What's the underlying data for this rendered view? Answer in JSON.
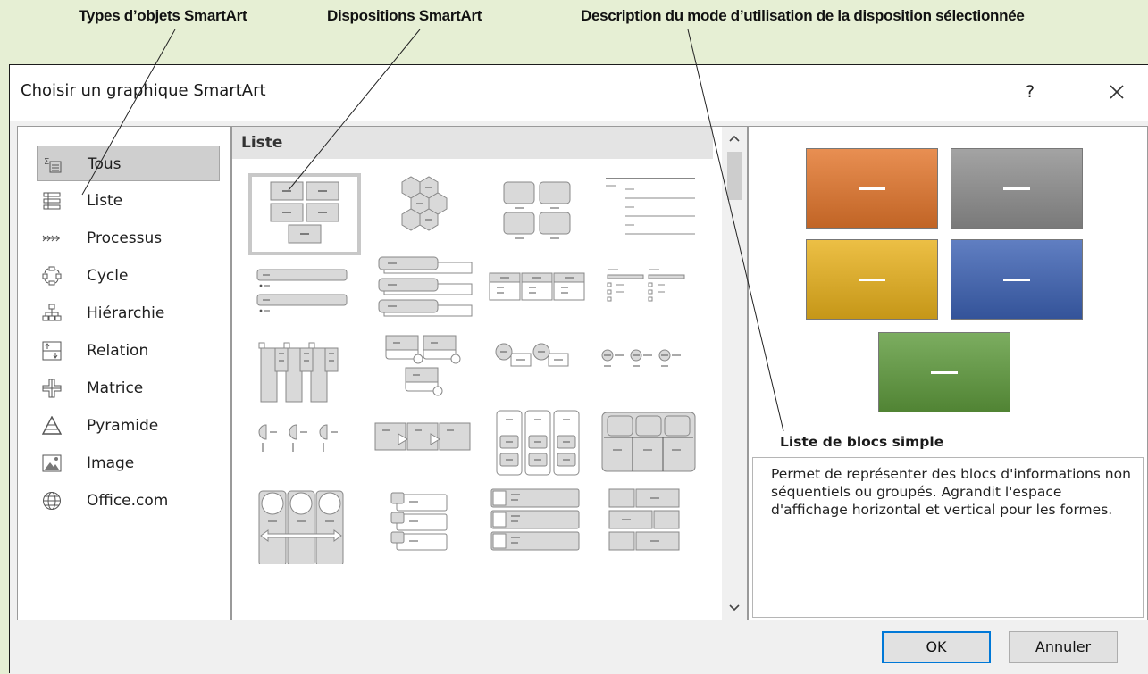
{
  "callouts": {
    "types": "Types d’objets SmartArt",
    "layouts": "Dispositions SmartArt",
    "description": "Description du mode d’utilisation de la disposition sélectionnée"
  },
  "dialog": {
    "title": "Choisir un graphique SmartArt",
    "help_label": "?",
    "close_label": "close"
  },
  "categories": [
    {
      "label": "Tous",
      "icon": "all-types-icon",
      "selected": true
    },
    {
      "label": "Liste",
      "icon": "list-icon"
    },
    {
      "label": "Processus",
      "icon": "process-icon"
    },
    {
      "label": "Cycle",
      "icon": "cycle-icon"
    },
    {
      "label": "Hiérarchie",
      "icon": "hierarchy-icon"
    },
    {
      "label": "Relation",
      "icon": "relationship-icon"
    },
    {
      "label": "Matrice",
      "icon": "matrix-icon"
    },
    {
      "label": "Pyramide",
      "icon": "pyramid-icon"
    },
    {
      "label": "Image",
      "icon": "picture-icon"
    },
    {
      "label": "Office.com",
      "icon": "globe-icon"
    }
  ],
  "layouts": {
    "header": "Liste",
    "thumbnails": [
      {
        "name": "basic-block-list",
        "selected": true
      },
      {
        "name": "hexagon-cluster"
      },
      {
        "name": "rounded-blocks-caption"
      },
      {
        "name": "lined-list"
      },
      {
        "name": "stacked-bars"
      },
      {
        "name": "tab-bars"
      },
      {
        "name": "three-column-lists"
      },
      {
        "name": "horizontal-bullet-lists"
      },
      {
        "name": "tabbed-columns"
      },
      {
        "name": "circle-accent-boxes"
      },
      {
        "name": "circle-label-boxes"
      },
      {
        "name": "circle-timeline"
      },
      {
        "name": "half-circle-list"
      },
      {
        "name": "arrow-process-boxes"
      },
      {
        "name": "three-column-icons"
      },
      {
        "name": "rounded-top-columns"
      },
      {
        "name": "circle-arrow-columns"
      },
      {
        "name": "picture-lines"
      },
      {
        "name": "picture-bullet-lines"
      },
      {
        "name": "grid-blocks"
      }
    ]
  },
  "preview": {
    "blocks": [
      {
        "color": "#e3762c"
      },
      {
        "color": "#8f8f8f"
      },
      {
        "color": "#e8b11c"
      },
      {
        "color": "#3d62b4"
      },
      {
        "color": "#5f9b3d"
      }
    ],
    "name": "Liste de blocs simple",
    "description": "Permet de représenter des blocs d'informations non séquentiels ou groupés. Agrandit l'espace d'affichage horizontal et vertical pour les formes."
  },
  "buttons": {
    "ok": "OK",
    "cancel": "Annuler"
  },
  "colors": {
    "background": "#e6efd4",
    "ok_border": "#0078d7",
    "selected_category": "#cfcfcf"
  }
}
